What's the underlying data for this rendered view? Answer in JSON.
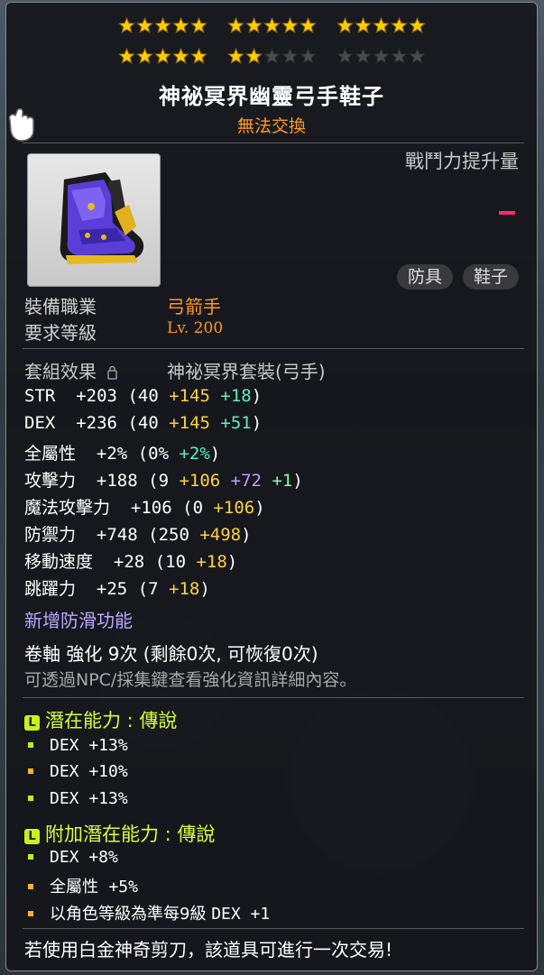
{
  "stars": {
    "total": 30,
    "filled": 22,
    "filled_color": "#ffcc00",
    "empty_color": "#4a4a4a"
  },
  "item": {
    "name": "神祕冥界幽靈弓手鞋子",
    "trade_status": "無法交換",
    "icon": "purple-boot-icon",
    "power_label": "戰鬥力提升量",
    "power_value": "-",
    "tags": [
      "防具",
      "鞋子"
    ]
  },
  "requirements": {
    "job_label": "裝備職業",
    "job_value": "弓箭手",
    "level_label": "要求等級",
    "level_value": "Lv. 200"
  },
  "set": {
    "label": "套組效果",
    "name": "神祕冥界套裝(弓手)"
  },
  "stats": {
    "str": {
      "name": "STR",
      "total": "+203",
      "open": "(40 ",
      "a": "+145",
      "b": "+18",
      "close": ")"
    },
    "dex": {
      "name": "DEX",
      "total": "+236",
      "open": "(40 ",
      "a": "+145",
      "b": "+51",
      "close": ")"
    },
    "allstat": {
      "name": "全屬性",
      "total": "+2%",
      "open": "(0% ",
      "a": "+2%",
      "close": ")"
    },
    "att": {
      "name": "攻擊力",
      "total": "+188",
      "open": "(9 ",
      "a": "+106",
      "b": "+72",
      "c": "+1",
      "close": ")"
    },
    "matt": {
      "name": "魔法攻擊力",
      "total": "+106",
      "open": "(0 ",
      "a": "+106",
      "close": ")"
    },
    "def": {
      "name": "防禦力",
      "total": "+748",
      "open": "(250 ",
      "a": "+498",
      "close": ")"
    },
    "speed": {
      "name": "移動速度",
      "total": "+28",
      "open": "(10 ",
      "a": "+18",
      "close": ")"
    },
    "jump": {
      "name": "跳躍力",
      "total": "+25",
      "open": "(7 ",
      "a": "+18",
      "close": ")"
    }
  },
  "anti_slip": "新增防滑功能",
  "scroll_text": "卷軸 強化 9次 (剩餘0次, 可恢復0次)",
  "hint_text": "可透過NPC/採集鍵查看強化資訊詳細內容。",
  "potential": {
    "badge": "L",
    "header": "潛在能力 : 傳說",
    "lines": [
      "DEX +13%",
      "DEX +10%",
      "DEX +13%"
    ]
  },
  "additional": {
    "badge": "L",
    "header": "附加潛在能力 : 傳說",
    "line1": "DEX +8%",
    "line2_name": "全屬性",
    "line2_val": "+5%",
    "line3_name": "以角色等級為準每9級",
    "line3_val": "DEX +1"
  },
  "footer": "若使用白金神奇剪刀，該道具可進行一次交易!"
}
